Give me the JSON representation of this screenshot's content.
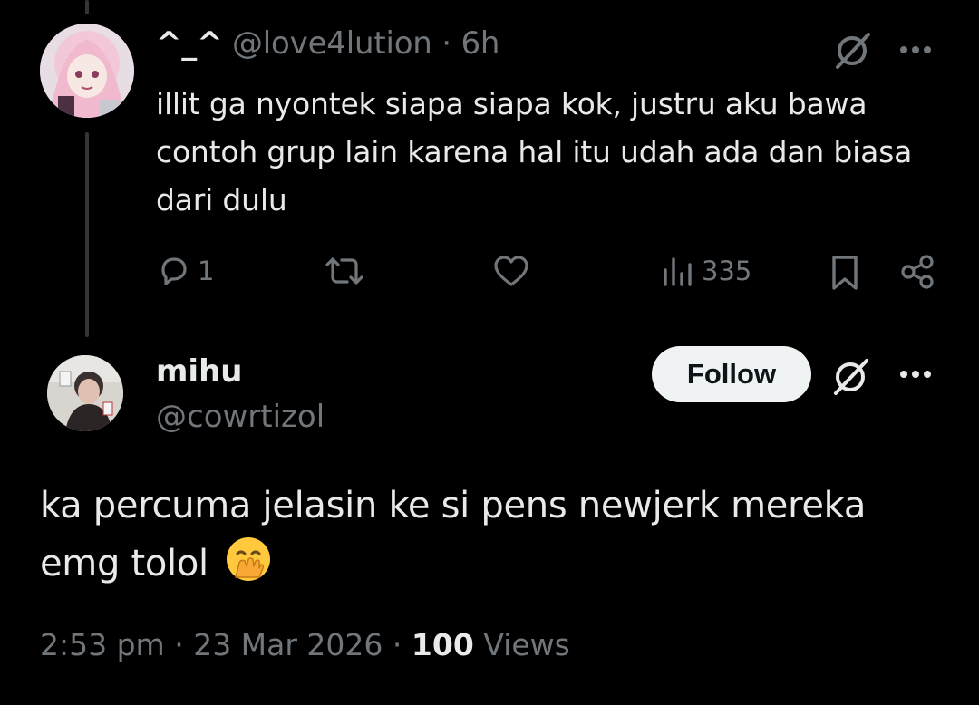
{
  "reply": {
    "display_name": "^_^",
    "handle": "@love4lution",
    "time": "6h",
    "text": "illit ga nyontek siapa siapa kok, justru aku bawa contoh grup lain karena hal itu udah ada dan biasa dari dulu",
    "reply_count": "1",
    "views": "335"
  },
  "main_post": {
    "display_name": "mihu",
    "handle": "@cowrtizol",
    "follow_label": "Follow",
    "text": "ka percuma jelasin ke si pens newjerk mereka emg tolol",
    "emoji": "face-with-hand-over-mouth",
    "timestamp": "2:53 pm",
    "date": "23 Mar 2026",
    "views_count": "100",
    "views_label": "Views"
  },
  "colors": {
    "background": "#000000",
    "text_primary": "#e7e9ea",
    "text_secondary": "#71767b",
    "follow_button_bg": "#eff3f4",
    "thread_line": "#333639",
    "emoji_yellow": "#ffc83d"
  },
  "icons": [
    "grok-icon",
    "more-icon",
    "reply-icon",
    "retweet-icon",
    "like-icon",
    "views-icon",
    "bookmark-icon",
    "share-icon"
  ]
}
